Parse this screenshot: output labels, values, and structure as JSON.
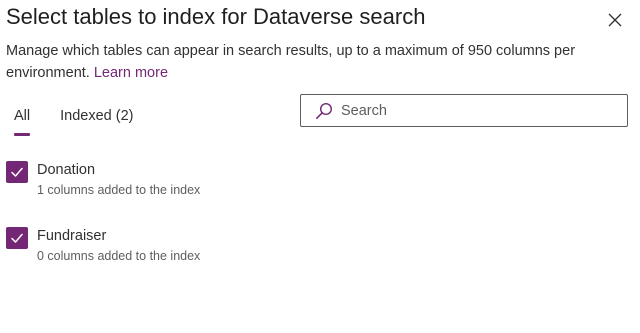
{
  "dialog": {
    "title": "Select tables to index for Dataverse search",
    "description": "Manage which tables can appear in search results, up to a maximum of 950 columns per environment.",
    "learn_more": "Learn more",
    "close_icon": "close-icon"
  },
  "tabs": [
    {
      "label": "All",
      "active": true
    },
    {
      "label": "Indexed (2)",
      "active": false
    }
  ],
  "search": {
    "placeholder": "Search",
    "value": "",
    "icon": "search-icon"
  },
  "tables": [
    {
      "name": "Donation",
      "subtitle": "1 columns added to the index",
      "checked": true
    },
    {
      "name": "Fundraiser",
      "subtitle": "0 columns added to the index",
      "checked": true
    }
  ],
  "colors": {
    "accent": "#742774",
    "text": "#323130",
    "subtext": "#605e5c"
  }
}
